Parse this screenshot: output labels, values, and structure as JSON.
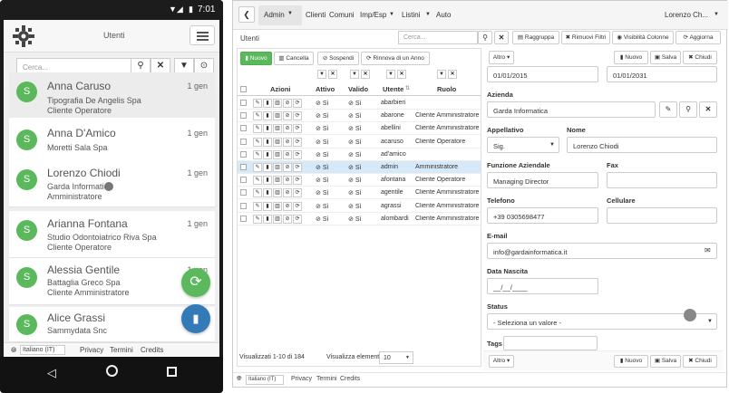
{
  "mobile": {
    "status_time": "7:01",
    "title": "Utenti",
    "search_placeholder": "Cerca...",
    "contacts": [
      {
        "initial": "S",
        "name": "Anna Caruso",
        "date": "1 gen",
        "company": "Tipografia De Angelis Spa",
        "role": "Cliente Operatore"
      },
      {
        "initial": "S",
        "name": "Anna D'Amico",
        "date": "1 gen",
        "company": "Moretti Sala Spa",
        "role": ""
      },
      {
        "initial": "S",
        "name": "Lorenzo Chiodi",
        "date": "1 gen",
        "company": "Garda Informatica",
        "role": "Amministratore"
      },
      {
        "initial": "S",
        "name": "Arianna Fontana",
        "date": "1 gen",
        "company": "Studio Odontoiatrico Riva Spa",
        "role": "Cliente Operatore"
      },
      {
        "initial": "S",
        "name": "Alessia Gentile",
        "date": "1 gen",
        "company": "Battaglia Greco Spa",
        "role": "Cliente Amministratore"
      },
      {
        "initial": "S",
        "name": "Alice Grassi",
        "date": "",
        "company": "Sammydata Snc",
        "role": ""
      }
    ],
    "footer": {
      "language": "Italiano (IT)",
      "privacy": "Privacy",
      "terms": "Termini",
      "credits": "Credits"
    }
  },
  "desktop": {
    "nav": {
      "admin": "Admin",
      "clienti": "Clienti",
      "comuni": "Comuni",
      "impesp": "Imp/Esp",
      "listini": "Listini",
      "auto": "Auto",
      "user": "Lorenzo Ch..."
    },
    "section_title": "Utenti",
    "search_placeholder": "Cerca...",
    "toolbar": {
      "raggruppa": "Raggruppa",
      "rimuovi_filtri": "Rimuovi Filtri",
      "visibilita": "Visibilità Colonne",
      "aggiorna": "Aggiorna"
    },
    "actions": {
      "nuovo": "Nuovo",
      "cancella": "Cancella",
      "sospendi": "Sospendi",
      "rinnova": "Rinnova di un Anno"
    },
    "columns": {
      "azioni": "Azioni",
      "attivo": "Attivo",
      "valido": "Valido",
      "utente": "Utente",
      "ruolo": "Ruolo"
    },
    "rows": [
      {
        "attivo": "Sì",
        "valido": "Sì",
        "utente": "abarbieri",
        "ruolo": ""
      },
      {
        "attivo": "Sì",
        "valido": "Sì",
        "utente": "abarone",
        "ruolo": "Cliente Amministratore"
      },
      {
        "attivo": "Sì",
        "valido": "Sì",
        "utente": "abellini",
        "ruolo": "Cliente Amministratore"
      },
      {
        "attivo": "Sì",
        "valido": "Sì",
        "utente": "acaruso",
        "ruolo": "Cliente Operatore"
      },
      {
        "attivo": "Sì",
        "valido": "Sì",
        "utente": "ad'amico",
        "ruolo": ""
      },
      {
        "attivo": "Sì",
        "valido": "Sì",
        "utente": "admin",
        "ruolo": "Amministratore"
      },
      {
        "attivo": "Sì",
        "valido": "Sì",
        "utente": "afontana",
        "ruolo": "Cliente Operatore"
      },
      {
        "attivo": "Sì",
        "valido": "Sì",
        "utente": "agentile",
        "ruolo": "Cliente Amministratore"
      },
      {
        "attivo": "Sì",
        "valido": "Sì",
        "utente": "agrassi",
        "ruolo": "Cliente Amministratore"
      },
      {
        "attivo": "Sì",
        "valido": "Sì",
        "utente": "alombardi",
        "ruolo": "Cliente Amministratore"
      }
    ],
    "pager": {
      "info": "Visualizzati 1-10 di 184",
      "label": "Visualizza elementi",
      "value": "10"
    },
    "detail": {
      "altro": "Altro",
      "nuovo": "Nuovo",
      "salva": "Salva",
      "chiudi": "Chiudi",
      "date_from": "01/01/2015",
      "date_to": "01/01/2031",
      "azienda_label": "Azienda",
      "azienda": "Garda Informatica",
      "appellativo_label": "Appellativo",
      "appellativo": "Sig.",
      "nome_label": "Nome",
      "nome": "Lorenzo Chiodi",
      "funzione_label": "Funzione Aziendale",
      "funzione": "Managing Director",
      "fax_label": "Fax",
      "telefono_label": "Telefono",
      "telefono": "+39 0305698477",
      "cellulare_label": "Cellulare",
      "email_label": "E-mail",
      "email": "info@gardainformatica.it",
      "nascita_label": "Data Nascita",
      "nascita": "__/__/____",
      "status_label": "Status",
      "status": "- Seleziona un valore -",
      "tags_label": "Tags"
    },
    "footer": {
      "language": "Italiano (IT)",
      "privacy": "Privacy",
      "terms": "Termini",
      "credits": "Credits"
    }
  }
}
